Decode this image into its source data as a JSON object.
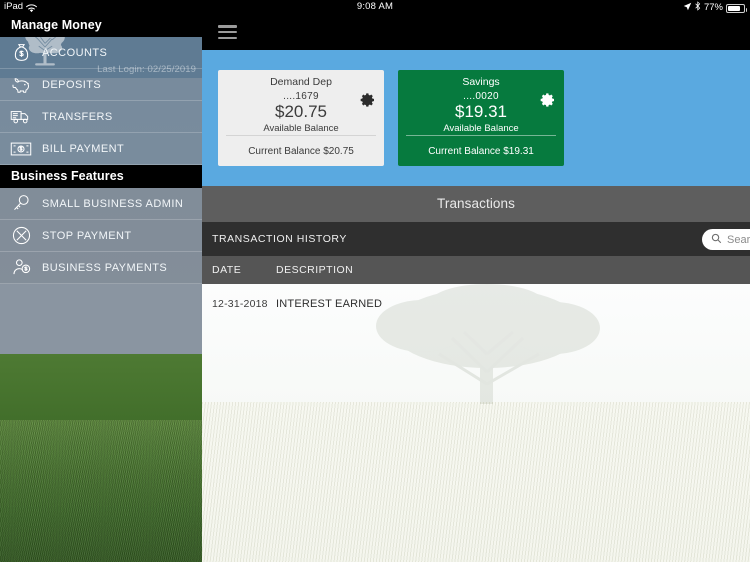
{
  "statusbar": {
    "device": "iPad",
    "wifi_icon": "wifi-icon",
    "time": "9:08 AM",
    "location_icon": "location-arrow-icon",
    "bluetooth_icon": "bluetooth-icon",
    "battery_percent": "77%",
    "battery_level": 77
  },
  "sidebar": {
    "logo_icon": "tree-logo-icon",
    "last_login_label": "Last Login:  02/25/2019",
    "sections": [
      {
        "title": "Manage Money",
        "items": [
          {
            "label": "ACCOUNTS",
            "icon": "money-bag-icon"
          },
          {
            "label": "DEPOSITS",
            "icon": "piggy-bank-icon"
          },
          {
            "label": "TRANSFERS",
            "icon": "delivery-truck-icon"
          },
          {
            "label": "BILL PAYMENT",
            "icon": "check-payment-icon"
          }
        ]
      },
      {
        "title": "Business Features",
        "items": [
          {
            "label": "SMALL BUSINESS ADMIN",
            "icon": "key-icon"
          },
          {
            "label": "STOP PAYMENT",
            "icon": "circle-x-icon"
          },
          {
            "label": "BUSINESS PAYMENTS",
            "icon": "money-person-icon"
          }
        ]
      }
    ]
  },
  "main": {
    "menu_icon": "hamburger-menu-icon",
    "accounts": [
      {
        "name": "Demand Dep",
        "number": "....1679",
        "amount": "$20.75",
        "amount_label": "Available Balance",
        "current_balance": "Current Balance $20.75",
        "gear_icon": "gear-icon",
        "theme": "light"
      },
      {
        "name": "Savings",
        "number": "....0020",
        "amount": "$19.31",
        "amount_label": "Available Balance",
        "current_balance": "Current Balance $19.31",
        "gear_icon": "gear-icon",
        "theme": "green"
      }
    ],
    "transactions_title": "Transactions",
    "history_title": "TRANSACTION HISTORY",
    "search": {
      "placeholder": "Search",
      "icon": "search-icon"
    },
    "columns": {
      "date": "DATE",
      "description": "DESCRIPTION"
    },
    "rows": [
      {
        "date": "12-31-2018",
        "description": "INTEREST EARNED"
      }
    ],
    "background_icon": "tree-watermark-icon"
  },
  "colors": {
    "banner_blue": "#5aa9e0",
    "savings_green": "#067a3e",
    "sidebar_header_blue": "#4d6e8a",
    "transactions_bar": "#5e5e5e",
    "history_bar": "#2f2f2f",
    "column_header": "#555555"
  }
}
